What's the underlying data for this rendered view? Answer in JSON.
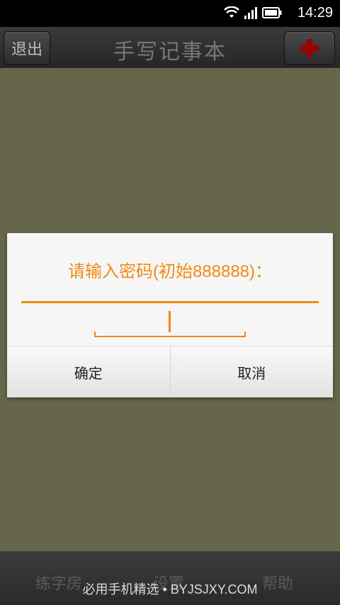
{
  "status_bar": {
    "time": "14:29"
  },
  "header": {
    "back_label": "退出",
    "title": "手写记事本"
  },
  "dialog": {
    "prompt": "请输入密码(初始888888)：",
    "password_value": "",
    "confirm_label": "确定",
    "cancel_label": "取消"
  },
  "bottom_nav": {
    "items": [
      {
        "label": "练字房"
      },
      {
        "label": "设置"
      },
      {
        "label": "帮助"
      }
    ]
  },
  "watermark": "必用手机精选 • BYJSJXY.COM",
  "colors": {
    "accent": "#f08a12",
    "background": "#66664a",
    "add_icon": "#a00000"
  }
}
